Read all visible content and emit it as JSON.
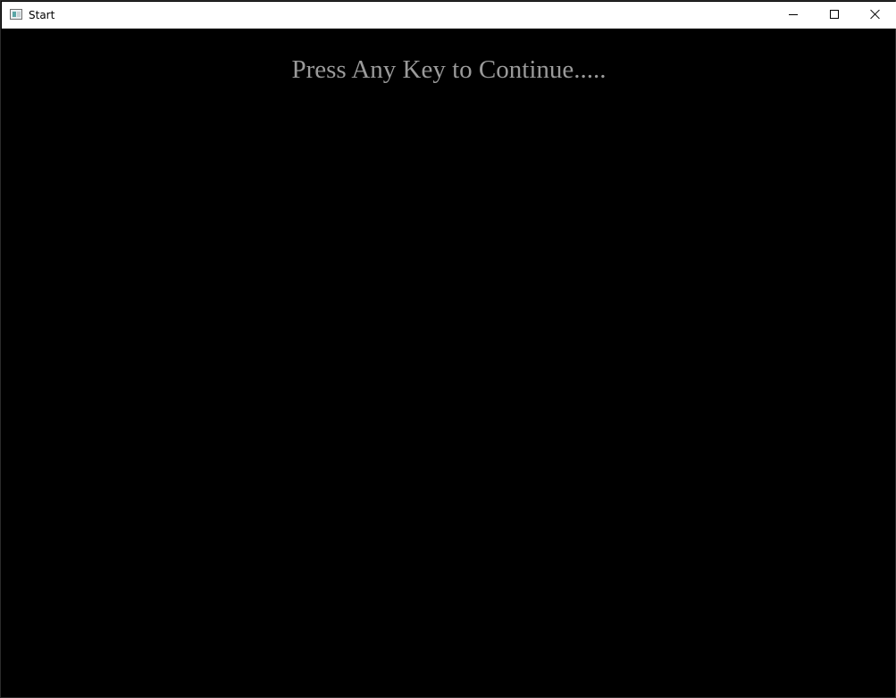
{
  "window": {
    "title": "Start",
    "icon": "app-window-icon"
  },
  "controls": {
    "minimize_icon": "minimize-icon",
    "maximize_icon": "maximize-icon",
    "close_icon": "close-icon"
  },
  "screen": {
    "prompt": "Press Any Key to Continue.....",
    "background_color": "#000000",
    "text_color": "#9a9a9a"
  }
}
